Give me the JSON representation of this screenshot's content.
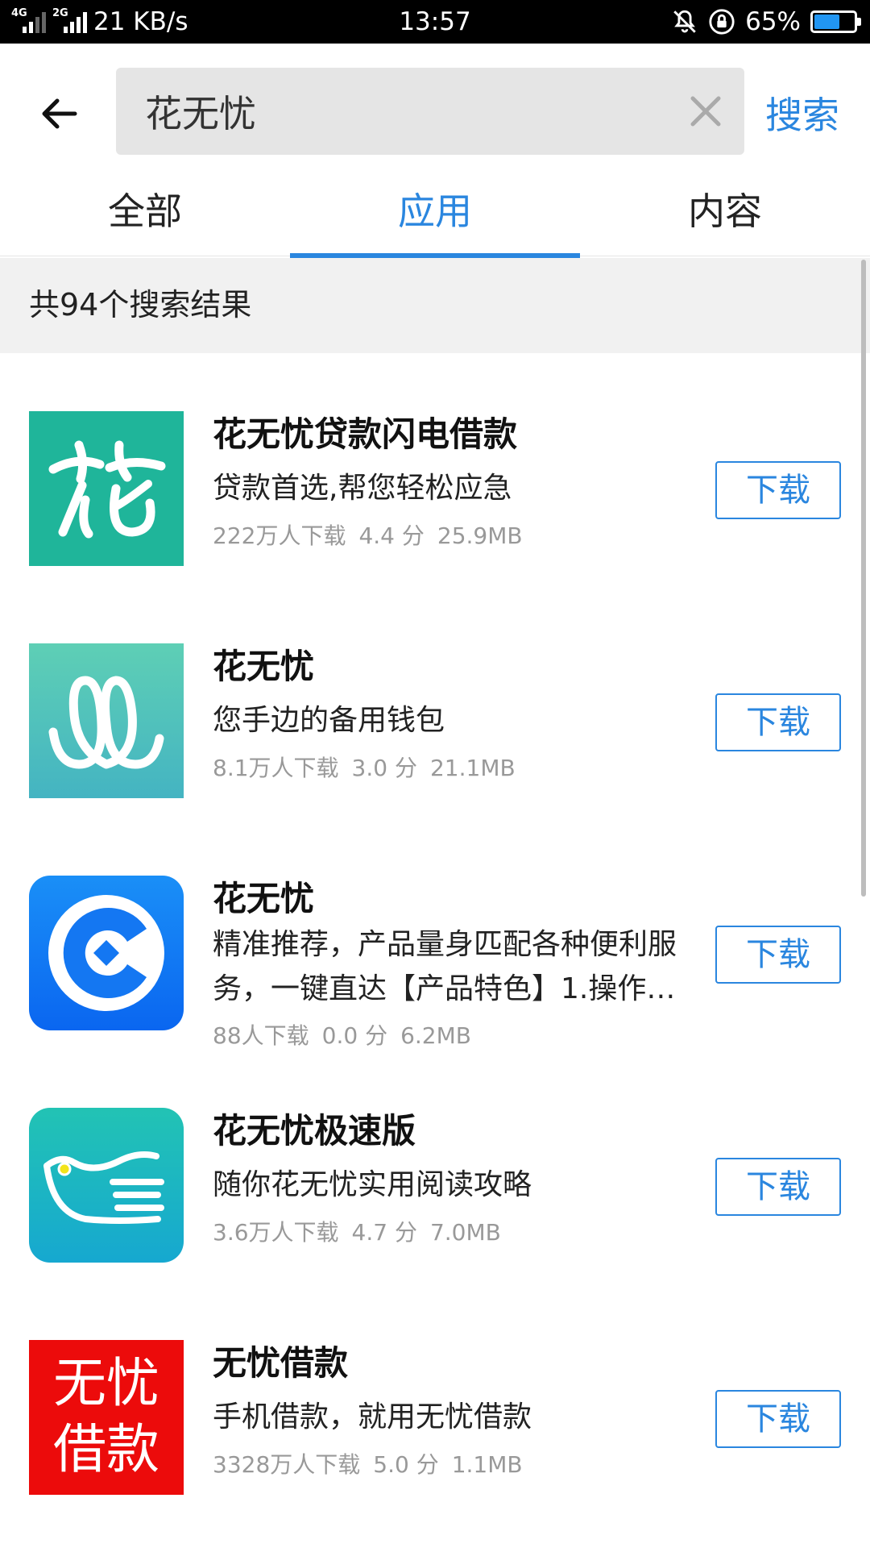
{
  "status_bar": {
    "net_left": "4G",
    "net_right": "2G",
    "speed": "21 KB/s",
    "time": "13:57",
    "battery": "65%",
    "battery_level": 0.65,
    "battery_color": "#2196F3"
  },
  "search": {
    "query": "花无忧",
    "button": "搜索"
  },
  "tabs": [
    "全部",
    "应用",
    "内容"
  ],
  "active_tab": 1,
  "result_count": "共94个搜索结果",
  "accent_color": "#2a86df",
  "apps": [
    {
      "name": "花无忧贷款闪电借款",
      "desc": "贷款首选,帮您轻松应急",
      "downloads": "222万人下载",
      "rating": "4.4 分",
      "size": "25.9MB",
      "button": "下载",
      "icon": "flower-glyph-icon",
      "icon_color": "#1fb59a"
    },
    {
      "name": "花无忧",
      "desc": "您手边的备用钱包",
      "downloads": "8.1万人下载",
      "rating": "3.0 分",
      "size": "21.1MB",
      "button": "下载",
      "icon": "double-loop-icon",
      "icon_color": "#4fc2b2"
    },
    {
      "name": "花无忧",
      "desc": "精准推荐，产品量身匹配各种便利服务，一键直达【产品特色】1.操作…",
      "downloads": "88人下载",
      "rating": "0.0 分",
      "size": "6.2MB",
      "button": "下载",
      "icon": "c-diamond-icon",
      "icon_color": "#1677f5"
    },
    {
      "name": "花无忧极速版",
      "desc": "随你花无忧实用阅读攻略",
      "downloads": "3.6万人下载",
      "rating": "4.7 分",
      "size": "7.0MB",
      "button": "下载",
      "icon": "bird-icon",
      "icon_color": "#19b3c4"
    },
    {
      "name": "无忧借款",
      "desc": "手机借款，就用无忧借款",
      "downloads": "3328万人下载",
      "rating": "5.0 分",
      "size": "1.1MB",
      "button": "下载",
      "icon": "text-logo-icon",
      "icon_text_1": "无忧",
      "icon_text_2": "借款",
      "icon_color": "#ec0b0b"
    }
  ]
}
